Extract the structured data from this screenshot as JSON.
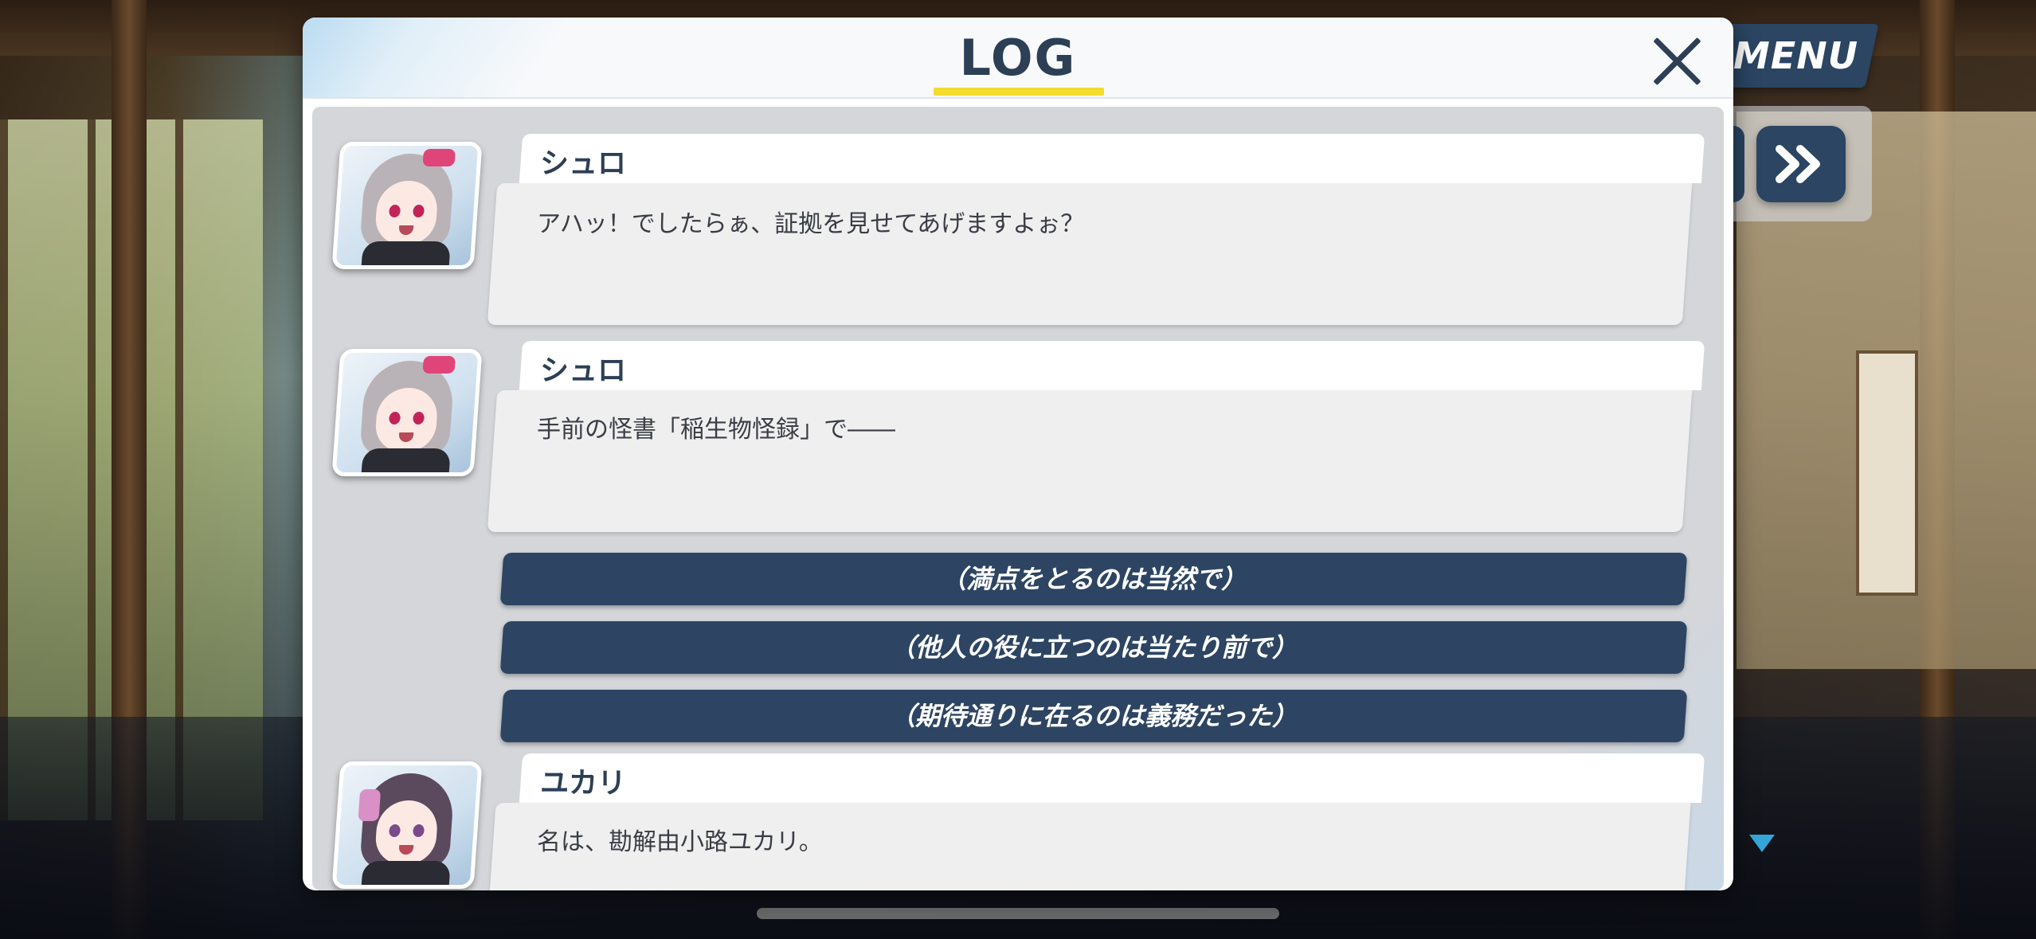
{
  "log": {
    "title": "LOG",
    "close_icon": "close-icon"
  },
  "entries": [
    {
      "speaker": "シュロ",
      "message": "アハッ！でしたらぁ、証拠を見せてあげますよぉ？",
      "avatar": "shuro-portrait"
    },
    {
      "speaker": "シュロ",
      "message": "手前の怪書「稲生物怪録」で――",
      "avatar": "shuro-portrait"
    },
    {
      "speaker": "ユカリ",
      "message": "名は、勘解由小路ユカリ。",
      "avatar": "yukari-portrait"
    }
  ],
  "choices": [
    "（満点をとるのは当然で）",
    "（他人の役に立つのは当たり前で）",
    "（期待通りに在るのは義務だった）"
  ],
  "controls": {
    "menu_label": "MENU",
    "fast_forward_icon": "fast-forward-icon",
    "next_indicator_icon": "triangle-down-icon"
  },
  "colors": {
    "panel_title": "#2d3f55",
    "title_underline": "#f3dc2e",
    "choice_bg": "#2d4563",
    "menu_bg": "#2b4563"
  }
}
